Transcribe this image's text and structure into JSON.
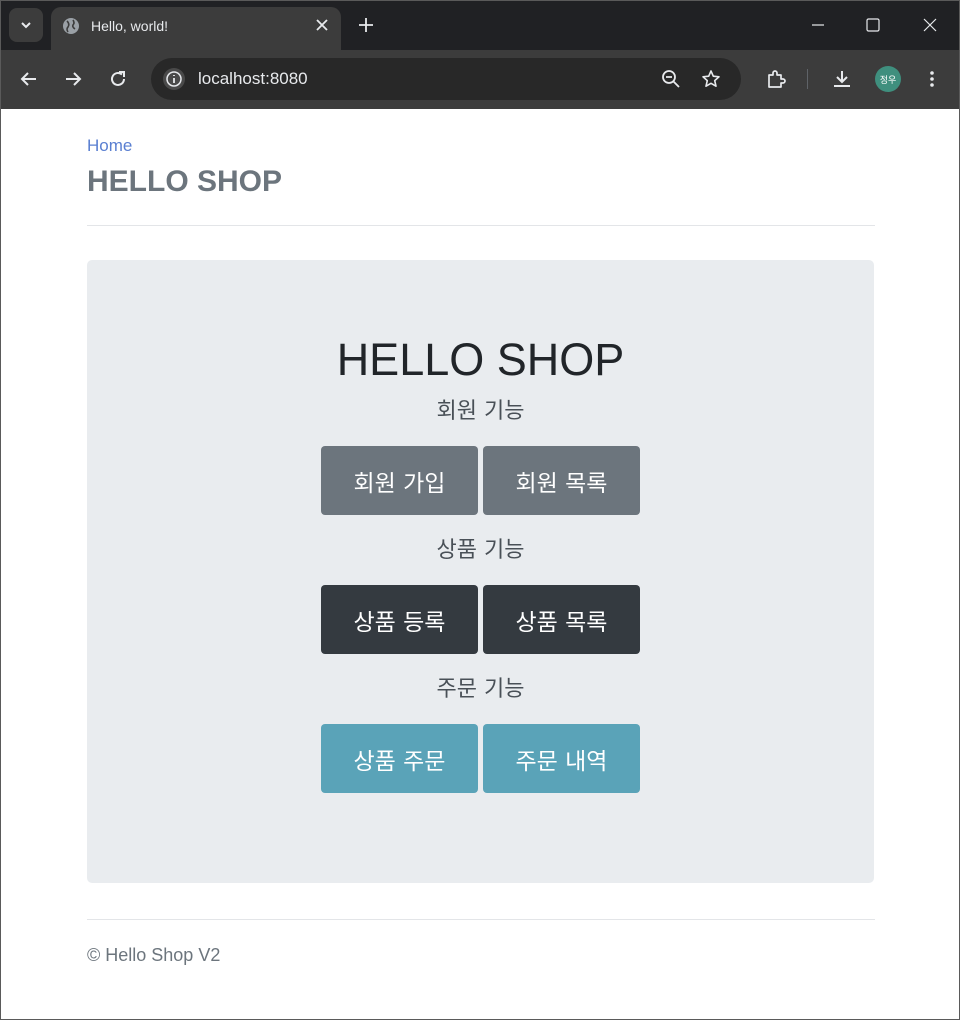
{
  "browser": {
    "tab_title": "Hello, world!",
    "url": "localhost:8080",
    "profile_initials": "정우",
    "icons": [
      "tab-search-icon",
      "globe-icon",
      "close-icon",
      "plus-icon",
      "minimize-icon",
      "maximize-icon",
      "window-close-icon",
      "back-arrow-icon",
      "forward-arrow-icon",
      "reload-icon",
      "site-info-icon",
      "zoom-out-icon",
      "star-icon",
      "extensions-icon",
      "download-icon",
      "kebab-menu-icon"
    ]
  },
  "header": {
    "breadcrumb": "Home",
    "title": "HELLO SHOP"
  },
  "jumbotron": {
    "title": "HELLO SHOP",
    "sections": [
      {
        "label": "회원 기능",
        "buttons": [
          "회원 가입",
          "회원 목록"
        ]
      },
      {
        "label": "상품 기능",
        "buttons": [
          "상품 등록",
          "상품 목록"
        ]
      },
      {
        "label": "주문 기능",
        "buttons": [
          "상품 주문",
          "주문 내역"
        ]
      }
    ]
  },
  "footer": {
    "text": "© Hello Shop V2"
  },
  "colors": {
    "secondary": "#6c757d",
    "dark": "#343a40",
    "info": "#5aa3b8",
    "jumbotron_bg": "#e9ecef",
    "link": "#5a7fd1"
  }
}
